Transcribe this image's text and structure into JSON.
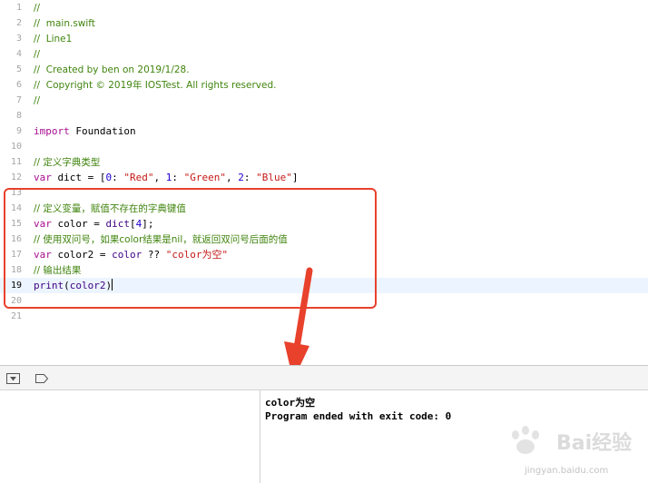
{
  "editor": {
    "lines": [
      {
        "number": "1",
        "tokens": [
          {
            "t": "//",
            "c": "comment"
          }
        ]
      },
      {
        "number": "2",
        "tokens": [
          {
            "t": "//  main.swift",
            "c": "comment"
          }
        ]
      },
      {
        "number": "3",
        "tokens": [
          {
            "t": "//  Line1",
            "c": "comment"
          }
        ]
      },
      {
        "number": "4",
        "tokens": [
          {
            "t": "//",
            "c": "comment"
          }
        ]
      },
      {
        "number": "5",
        "tokens": [
          {
            "t": "//  Created by ben on 2019/1/28.",
            "c": "comment"
          }
        ]
      },
      {
        "number": "6",
        "tokens": [
          {
            "t": "//  Copyright © 2019年 IOSTest. All rights reserved.",
            "c": "comment"
          }
        ]
      },
      {
        "number": "7",
        "tokens": [
          {
            "t": "//",
            "c": "comment"
          }
        ]
      },
      {
        "number": "8",
        "tokens": []
      },
      {
        "number": "9",
        "tokens": [
          {
            "t": "import",
            "c": "keyword"
          },
          {
            "t": " Foundation",
            "c": "ident"
          }
        ]
      },
      {
        "number": "10",
        "tokens": []
      },
      {
        "number": "11",
        "tokens": [
          {
            "t": "// 定义字典类型",
            "c": "comment"
          }
        ]
      },
      {
        "number": "12",
        "tokens": [
          {
            "t": "var",
            "c": "keyword"
          },
          {
            "t": " dict = [",
            "c": "ident"
          },
          {
            "t": "0",
            "c": "number"
          },
          {
            "t": ": ",
            "c": "punct"
          },
          {
            "t": "\"Red\"",
            "c": "string"
          },
          {
            "t": ", ",
            "c": "punct"
          },
          {
            "t": "1",
            "c": "number"
          },
          {
            "t": ": ",
            "c": "punct"
          },
          {
            "t": "\"Green\"",
            "c": "string"
          },
          {
            "t": ", ",
            "c": "punct"
          },
          {
            "t": "2",
            "c": "number"
          },
          {
            "t": ": ",
            "c": "punct"
          },
          {
            "t": "\"Blue\"",
            "c": "string"
          },
          {
            "t": "]",
            "c": "punct"
          }
        ]
      },
      {
        "number": "13",
        "tokens": []
      },
      {
        "number": "14",
        "tokens": [
          {
            "t": "// 定义变量，赋值不存在的字典键值",
            "c": "comment"
          }
        ]
      },
      {
        "number": "15",
        "tokens": [
          {
            "t": "var",
            "c": "keyword"
          },
          {
            "t": " color = ",
            "c": "ident"
          },
          {
            "t": "dict",
            "c": "type"
          },
          {
            "t": "[",
            "c": "punct"
          },
          {
            "t": "4",
            "c": "number"
          },
          {
            "t": "];",
            "c": "punct"
          }
        ]
      },
      {
        "number": "16",
        "tokens": [
          {
            "t": "// 使用双问号，如果color结果是nil，就返回双问号后面的值",
            "c": "comment"
          }
        ]
      },
      {
        "number": "17",
        "tokens": [
          {
            "t": "var",
            "c": "keyword"
          },
          {
            "t": " color2 = ",
            "c": "ident"
          },
          {
            "t": "color",
            "c": "type"
          },
          {
            "t": " ?? ",
            "c": "punct"
          },
          {
            "t": "\"color为空\"",
            "c": "string"
          }
        ]
      },
      {
        "number": "18",
        "tokens": [
          {
            "t": "// 输出结果",
            "c": "comment"
          }
        ]
      },
      {
        "number": "19",
        "tokens": [
          {
            "t": "print",
            "c": "type"
          },
          {
            "t": "(",
            "c": "punct"
          },
          {
            "t": "color2",
            "c": "type"
          },
          {
            "t": ")",
            "c": "punct"
          }
        ],
        "current": true
      },
      {
        "number": "20",
        "tokens": []
      },
      {
        "number": "21",
        "tokens": []
      }
    ]
  },
  "debug_bar": {
    "hide_debug_icon": "hide-debug-area-icon",
    "breakpoint_icon": "breakpoint-toggle-icon"
  },
  "console": {
    "lines": [
      "color为空",
      "Program ended with exit code: 0"
    ]
  },
  "watermark": {
    "text": "Bai经验",
    "url": "jingyan.baidu.com"
  },
  "colors": {
    "comment": "#41850f",
    "keyword": "#a90d91",
    "string": "#c41a16",
    "number": "#1c00cf",
    "highlight": "#e8412c"
  }
}
